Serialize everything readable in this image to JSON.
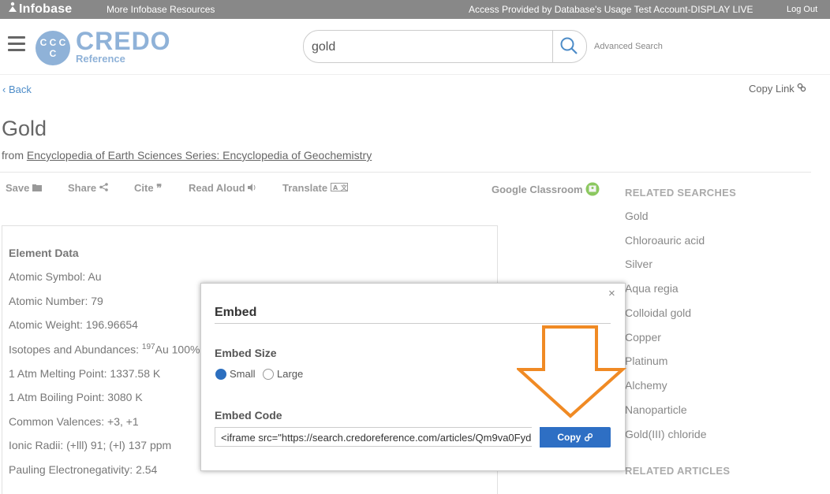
{
  "topbar": {
    "brand": "Infobase",
    "more_resources": "More Infobase Resources",
    "access": "Access Provided by Database's Usage Test Account-DISPLAY LIVE",
    "logout": "Log Out"
  },
  "header": {
    "logo_monogram": "C C C C",
    "logo_name": "CREDO",
    "logo_sub": "Reference",
    "search_value": "gold",
    "advanced_search": "Advanced Search"
  },
  "nav": {
    "back": "Back",
    "copy_link": "Copy Link"
  },
  "article": {
    "title": "Gold",
    "from_prefix": "from",
    "source": "Encyclopedia of Earth Sciences Series: Encyclopedia of Geochemistry"
  },
  "tools": {
    "save": "Save",
    "share": "Share",
    "cite": "Cite",
    "read_aloud": "Read Aloud",
    "translate": "Translate",
    "google_classroom": "Google Classroom"
  },
  "element_data": {
    "heading": "Element Data",
    "atomic_symbol": "Atomic Symbol: Au",
    "atomic_number": "Atomic Number: 79",
    "atomic_weight": "Atomic Weight: 196.96654",
    "isotopes_prefix": "Isotopes and Abundances: ",
    "isotopes_sup": "197",
    "isotopes_value": "Au 100%",
    "melting": "1 Atm Melting Point: 1337.58 K",
    "boiling": "1 Atm Boiling Point: 3080 K",
    "valences": "Common Valences: +3, +1",
    "ionic_radii": "Ionic Radii: (+lll) 91; (+l) 137 ppm",
    "pauling": "Pauling Electronegativity: 2.54"
  },
  "related": {
    "searches_heading": "RELATED SEARCHES",
    "items": [
      "Gold",
      "Chloroauric acid",
      "Silver",
      "Aqua regia",
      "Colloidal gold",
      "Copper",
      "Platinum",
      "Alchemy",
      "Nanoparticle",
      "Gold(III) chloride"
    ],
    "articles_heading": "RELATED ARTICLES"
  },
  "modal": {
    "close": "×",
    "title": "Embed",
    "size_label": "Embed Size",
    "size_options": [
      "Small",
      "Large"
    ],
    "selected_size": "Small",
    "code_label": "Embed Code",
    "code_value": "<iframe src=\"https://search.credoreference.com/articles/Qm9va0Fyd",
    "copy_button": "Copy"
  },
  "colors": {
    "topbar": "#888888",
    "logo": "#8fb2d8",
    "link": "#4d8cc8",
    "copy_button": "#2e6fc4",
    "arrow": "#f08a24"
  }
}
